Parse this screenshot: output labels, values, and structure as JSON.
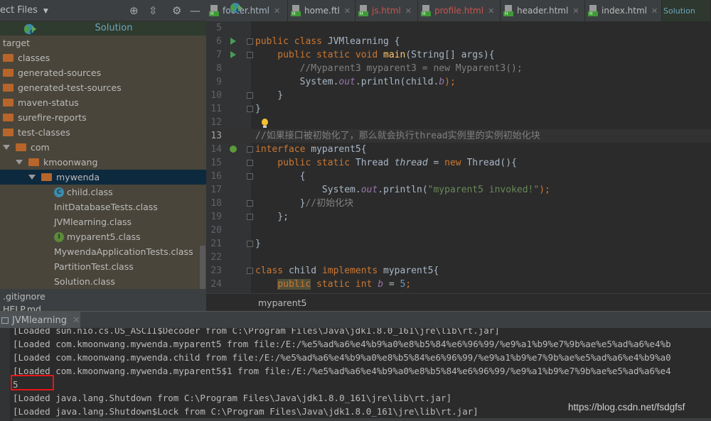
{
  "project_panel": {
    "title": "ect Files",
    "banner": "Solution",
    "tree": [
      {
        "label": "target",
        "indent": 0,
        "type": "plain"
      },
      {
        "label": "classes",
        "indent": 0,
        "type": "folder"
      },
      {
        "label": "generated-sources",
        "indent": 0,
        "type": "folder"
      },
      {
        "label": "generated-test-sources",
        "indent": 0,
        "type": "folder"
      },
      {
        "label": "maven-status",
        "indent": 0,
        "type": "folder"
      },
      {
        "label": "surefire-reports",
        "indent": 0,
        "type": "folder"
      },
      {
        "label": "test-classes",
        "indent": 0,
        "type": "folder"
      },
      {
        "label": "com",
        "indent": 1,
        "type": "folder-open"
      },
      {
        "label": "kmoonwang",
        "indent": 2,
        "type": "folder-open"
      },
      {
        "label": "mywenda",
        "indent": 3,
        "type": "folder-open",
        "selected": true
      },
      {
        "label": "child.class",
        "indent": 4,
        "type": "class"
      },
      {
        "label": "InitDatabaseTests.class",
        "indent": 4,
        "type": "class-test"
      },
      {
        "label": "JVMlearning.class",
        "indent": 4,
        "type": "class-run"
      },
      {
        "label": "myparent5.class",
        "indent": 4,
        "type": "interface"
      },
      {
        "label": "MywendaApplicationTests.class",
        "indent": 4,
        "type": "class-test"
      },
      {
        "label": "PartitionTest.class",
        "indent": 4,
        "type": "class-run"
      },
      {
        "label": "Solution.class",
        "indent": 4,
        "type": "class-run"
      }
    ],
    "bottom_items": [
      ".gitignore",
      "HELP.md"
    ]
  },
  "tabs": [
    {
      "label": "footer.html",
      "color": "#a9b7c6"
    },
    {
      "label": "home.ftl",
      "color": "#bbbbbb"
    },
    {
      "label": "js.html",
      "color": "#c75450"
    },
    {
      "label": "profile.html",
      "color": "#c75450"
    },
    {
      "label": "header.html",
      "color": "#bbbbbb"
    },
    {
      "label": "index.html",
      "color": "#bbbbbb"
    },
    {
      "label": "Solution",
      "color": "#6fa7bd",
      "active": true
    }
  ],
  "editor": {
    "current_line": 13,
    "lines": [
      {
        "n": "5",
        "t": []
      },
      {
        "n": "6",
        "run": true,
        "fold": true,
        "t": [
          [
            "public class ",
            "k"
          ],
          [
            "JVMlearning",
            "p"
          ],
          [
            " {",
            "p"
          ]
        ]
      },
      {
        "n": "7",
        "run": true,
        "fold": true,
        "t": [
          [
            "    public static void ",
            "k"
          ],
          [
            "main",
            "f"
          ],
          [
            "(String[] args){",
            "p"
          ]
        ]
      },
      {
        "n": "8",
        "t": [
          [
            "        //Myparent3 myparent3 = new Myparent3();",
            "c"
          ]
        ]
      },
      {
        "n": "9",
        "t": [
          [
            "        System.",
            "p"
          ],
          [
            "out",
            "st"
          ],
          [
            ".println(child.",
            "p"
          ],
          [
            "b",
            "st"
          ],
          [
            ");",
            "k"
          ]
        ]
      },
      {
        "n": "10",
        "fold": true,
        "t": [
          [
            "    }",
            "p"
          ]
        ]
      },
      {
        "n": "11",
        "fold": true,
        "t": [
          [
            "}",
            "p"
          ]
        ]
      },
      {
        "n": "12",
        "t": []
      },
      {
        "n": "13",
        "t": [
          [
            "//如果接口被初始化了，那么就会执行thread实例里的实例初始化块",
            "c"
          ]
        ]
      },
      {
        "n": "14",
        "fold": true,
        "t": [
          [
            "interface ",
            "k"
          ],
          [
            "myparent5",
            "p"
          ],
          [
            "{",
            "p"
          ]
        ]
      },
      {
        "n": "15",
        "fold": true,
        "t": [
          [
            "    public static ",
            "k"
          ],
          [
            "Thread ",
            "p"
          ],
          [
            "thread",
            "it"
          ],
          [
            " = ",
            "p"
          ],
          [
            "new ",
            "k"
          ],
          [
            "Thread(){",
            "p"
          ]
        ]
      },
      {
        "n": "16",
        "fold": true,
        "t": [
          [
            "        {",
            "p"
          ]
        ]
      },
      {
        "n": "17",
        "t": [
          [
            "            System.",
            "p"
          ],
          [
            "out",
            "st"
          ],
          [
            ".println(",
            "p"
          ],
          [
            "\"myparent5 invoked!\"",
            "s"
          ],
          [
            ");",
            "k"
          ]
        ]
      },
      {
        "n": "18",
        "fold": true,
        "t": [
          [
            "        }",
            "p"
          ],
          [
            "//初始化块",
            "c"
          ]
        ]
      },
      {
        "n": "19",
        "fold": true,
        "t": [
          [
            "    };",
            "p"
          ]
        ]
      },
      {
        "n": "20",
        "t": []
      },
      {
        "n": "21",
        "fold": true,
        "t": [
          [
            "}",
            "p"
          ]
        ]
      },
      {
        "n": "22",
        "t": []
      },
      {
        "n": "23",
        "fold": true,
        "t": [
          [
            "class ",
            "k"
          ],
          [
            "child ",
            "p"
          ],
          [
            "implements ",
            "k"
          ],
          [
            "myparent5{",
            "p"
          ]
        ]
      },
      {
        "n": "24",
        "t": [
          [
            "    ",
            "p"
          ],
          [
            "public",
            "k hl"
          ],
          [
            " static int ",
            "k"
          ],
          [
            "b",
            "st"
          ],
          [
            " = ",
            "p"
          ],
          [
            "5",
            "n"
          ],
          [
            ";",
            "k"
          ]
        ]
      }
    ]
  },
  "breadcrumb": "myparent5",
  "console": {
    "tab": "JVMlearning",
    "lines": [
      "[Loaded sun.nio.cs.US_ASCII$Decoder from C:\\Program Files\\Java\\jdk1.8.0_161\\jre\\lib\\rt.jar]",
      "[Loaded com.kmoonwang.mywenda.myparent5 from file:/E:/%e5%ad%a6%e4%b9%a0%e8%b5%84%e6%96%99/%e9%a1%b9%e7%9b%ae%e5%ad%a6%e4%b",
      "[Loaded com.kmoonwang.mywenda.child from file:/E:/%e5%ad%a6%e4%b9%a0%e8%b5%84%e6%96%99/%e9%a1%b9%e7%9b%ae%e5%ad%a6%e4%b9%a0",
      "[Loaded com.kmoonwang.mywenda.myparent5$1 from file:/E:/%e5%ad%a6%e4%b9%a0%e8%b5%84%e6%96%99/%e9%a1%b9%e7%9b%ae%e5%ad%a6%e4",
      "5",
      "[Loaded java.lang.Shutdown from C:\\Program Files\\Java\\jdk1.8.0_161\\jre\\lib\\rt.jar]",
      "[Loaded java.lang.Shutdown$Lock from C:\\Program Files\\Java\\jdk1.8.0_161\\jre\\lib\\rt.jar]"
    ]
  },
  "watermark": "https://blog.csdn.net/fsdgfsf"
}
